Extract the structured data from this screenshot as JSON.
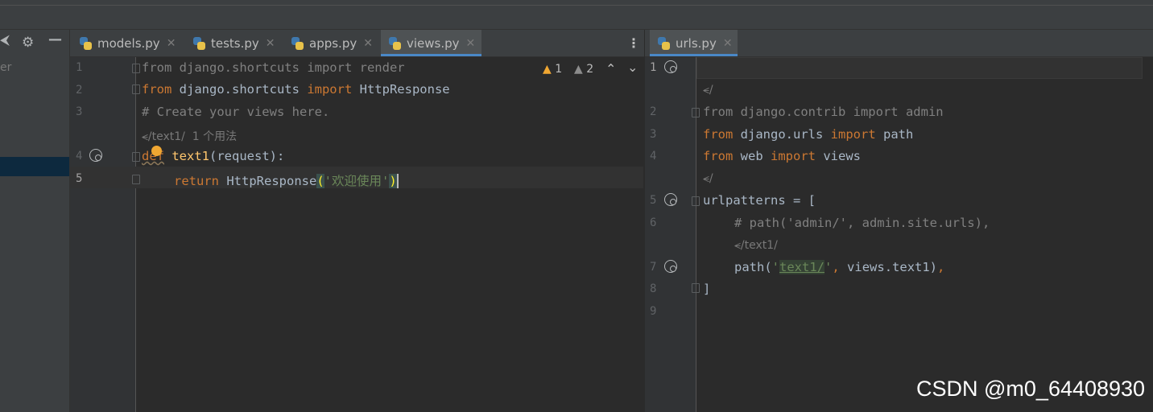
{
  "sidebar": {
    "label_fragment": "er",
    "gear_icon": "gear-icon",
    "collapse_icon": "minus-icon"
  },
  "left_tabs": [
    {
      "label": "models.py",
      "active": false
    },
    {
      "label": "tests.py",
      "active": false
    },
    {
      "label": "apps.py",
      "active": false
    },
    {
      "label": "views.py",
      "active": true
    }
  ],
  "right_tabs": [
    {
      "label": "urls.py",
      "active": true
    }
  ],
  "inspections": {
    "warnings": "1",
    "weak_warnings": "2"
  },
  "left_editor": {
    "line_numbers": [
      "1",
      "2",
      "3",
      "4",
      "5"
    ],
    "lines": [
      {
        "kw1": "from",
        "mod": " django.shortcuts ",
        "kw2": "import",
        "name": " render"
      },
      {
        "kw1": "from",
        "mod": " django.shortcuts ",
        "kw2": "import",
        "name": " HttpResponse"
      },
      {
        "comment": "# Create your views here."
      },
      {
        "kw": "def",
        "fn": "text1",
        "rest": "(request):"
      },
      {
        "kw": "return",
        "call": " HttpResponse",
        "open": "(",
        "str": "'欢迎使用'",
        "close": ")"
      }
    ],
    "usage_hint": {
      "route": "/text1/",
      "usages": "1 个用法"
    }
  },
  "right_editor": {
    "line_numbers": [
      "1",
      "2",
      "3",
      "4",
      "5",
      "6",
      "7",
      "8",
      "9"
    ],
    "route_hints": [
      "/",
      "/",
      "/text1/"
    ],
    "lines": {
      "l2": {
        "kw1": "from",
        "mod": " django.contrib ",
        "kw2": "import",
        "name": " admin"
      },
      "l3": {
        "kw1": "from",
        "mod": " django.urls ",
        "kw2": "import",
        "name": " path"
      },
      "l4": {
        "kw1": "from",
        "mod": " web ",
        "kw2": "import",
        "name": " views"
      },
      "l5": "urlpatterns = [",
      "l6": "# path('admin/', admin.site.urls),",
      "l7": {
        "pre": "path(",
        "q1": "'",
        "route": "text1/",
        "q2": "'",
        "comma": ",",
        "rest": " views.text1)",
        "end": ","
      },
      "l8": "]"
    }
  },
  "watermark": "CSDN @m0_64408930"
}
